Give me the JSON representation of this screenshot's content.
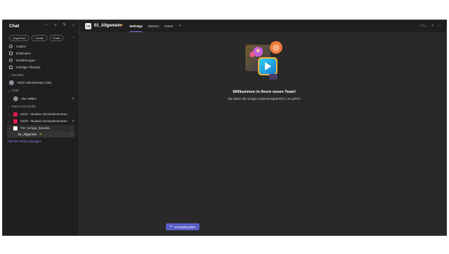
{
  "sidebar": {
    "title": "Chat",
    "tools": {
      "more": "⋯",
      "search": "⌕",
      "compose": "✎",
      "compose_chev": "⌄"
    },
    "filters": [
      "Ungelesen",
      "Kanäle",
      "Chats"
    ],
    "filter_chev": "⌄",
    "nav_items": [
      {
        "label": "Copilot",
        "icon": "copilot-icon"
      },
      {
        "label": "Entdecken",
        "icon": "discover-icon"
      },
      {
        "label": "Erwähnungen",
        "icon": "mention-icon"
      },
      {
        "label": "Gefolgte Threads",
        "icon": "threads-icon"
      }
    ],
    "sections": {
      "favorites": "Favoriten",
      "chats": "Chats",
      "teams": "Teams und Kanäle"
    },
    "favorites": [
      {
        "label": "MOD Administrator (Sie)"
      }
    ],
    "chats": [
      {
        "label": "Alex Wilber",
        "trailing": "✎"
      }
    ],
    "teams": [
      {
        "label": "GZ24 - Neubau Gemeindezentrum",
        "color": "#e3194c",
        "trailing": ""
      },
      {
        "label": "GZ23 - Neubau Gemeindezentrum",
        "color": "#e3194c",
        "trailing": "✎"
      },
      {
        "label": "TW_Vorlage_Bauakte",
        "color": "#ffffff",
        "trailing": "⋯"
      }
    ],
    "channel": {
      "label": "01_Allgemein",
      "trailing": "⋯"
    },
    "all_teams_link": "Alle Ihre Teams anzeigen"
  },
  "channel_header": {
    "avatar_text": "TW",
    "title": "01_Allgemein",
    "tabs": [
      {
        "label": "Beiträge",
        "active": true
      },
      {
        "label": "Dateien",
        "active": false
      },
      {
        "label": "Notes",
        "active": false
      }
    ],
    "add_tab": "+",
    "right_tools": [
      "▭⌄",
      "⌕",
      "⋯"
    ]
  },
  "welcome": {
    "title": "Willkommen in Ihrem neuen Team!",
    "subtitle": "Sie haben die Gruppe zusammengebracht. Los geht's!"
  },
  "post_button": {
    "label": "In Kanal posten",
    "icon": "compose-icon"
  },
  "colors": {
    "accent": "#5b5fc7",
    "tab_indicator": "#7f85f5",
    "team_red": "#e3194c",
    "link": "#8b8cf5"
  }
}
